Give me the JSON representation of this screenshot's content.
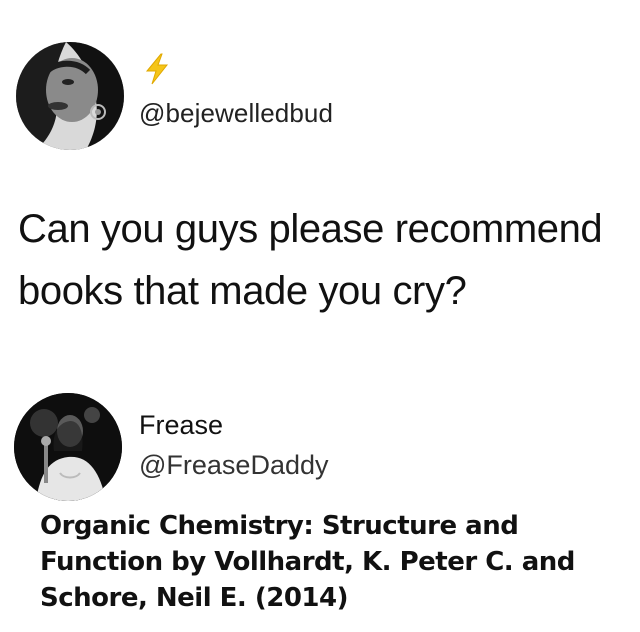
{
  "tweet": {
    "author_handle": "@bejewelledbud",
    "author_badge_icon": "lightning-bolt-emoji",
    "text": "Can you guys please recommend books that made you cry?"
  },
  "reply": {
    "author_name": "Frease",
    "author_handle": "@FreaseDaddy",
    "text": "Organic Chemistry: Structure and Function by Vollhardt, K. Peter C. and Schore, Neil E. (2014)"
  }
}
